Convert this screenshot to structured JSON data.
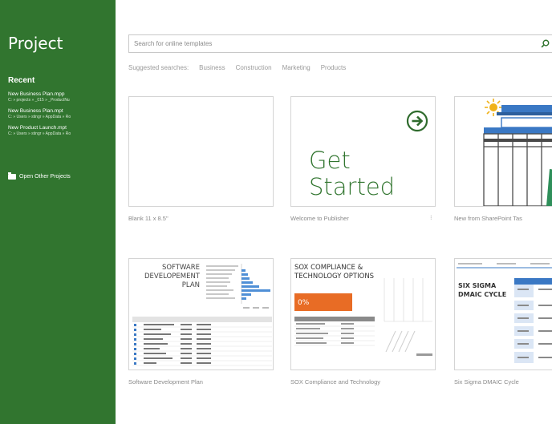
{
  "sidebar": {
    "app_title": "Project",
    "recent_heading": "Recent",
    "recent": [
      {
        "name": "New Business Plan.mpp",
        "path": "C: » projects » _015 » _ProductNu"
      },
      {
        "name": "New Business Plan.mpt",
        "path": "C: » Users » stingr » AppData » Ro"
      },
      {
        "name": "New Product Launch.mpt",
        "path": "C: » Users » stingr » AppData » Ro"
      }
    ],
    "open_other": "Open Other Projects"
  },
  "search": {
    "placeholder": "Search for online templates"
  },
  "suggested": {
    "label": "Suggested searches:",
    "items": [
      "Business",
      "Construction",
      "Marketing",
      "Products"
    ]
  },
  "templates": [
    {
      "label": "Blank 11 x 8.5\""
    },
    {
      "label": "Welcome to Publisher",
      "heading_line1": "Get",
      "heading_line2": "Started"
    },
    {
      "label": "New from SharePoint Tas"
    },
    {
      "label": "Software Development Plan",
      "thumb_title_1": "SOFTWARE",
      "thumb_title_2": "DEVELOPEMENT",
      "thumb_title_3": "PLAN"
    },
    {
      "label": "SOX Compliance and Technology",
      "thumb_title_1": "SOX COMPLIANCE &",
      "thumb_title_2": "TECHNOLOGY OPTIONS",
      "thumb_percent": "0%"
    },
    {
      "label": "Six Sigma DMAIC Cycle",
      "thumb_title_1": "SIX SIGMA",
      "thumb_title_2": "DMAIC CYCLE"
    }
  ],
  "colors": {
    "sidebar": "#31752f",
    "accent": "#31752f",
    "sox_orange": "#e86c25",
    "sharepoint_blue": "#3a78c4"
  }
}
